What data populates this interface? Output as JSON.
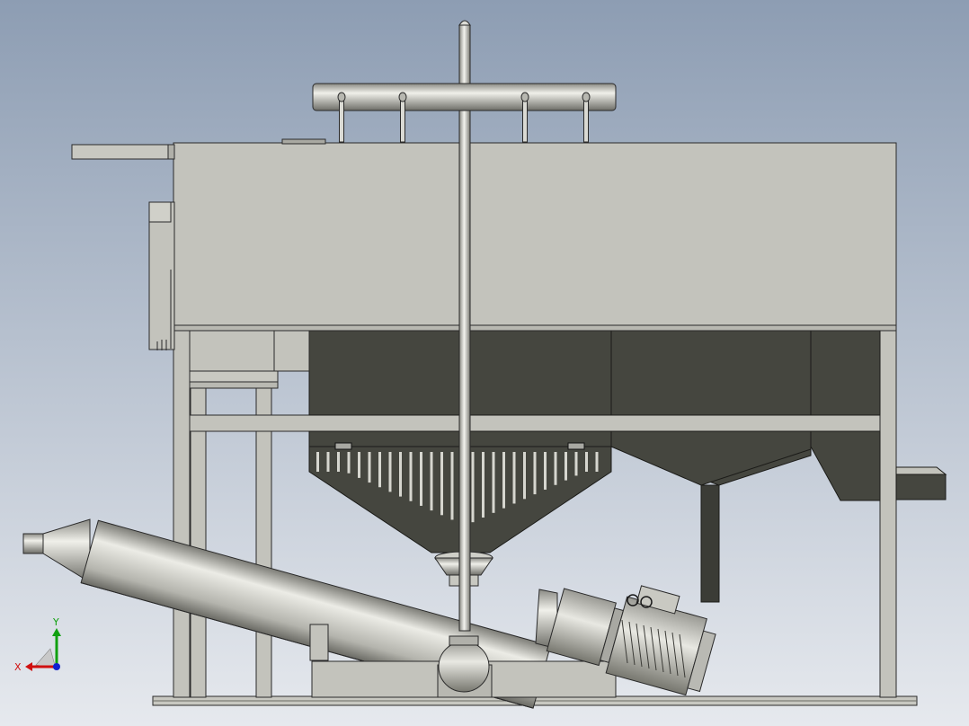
{
  "viewport": {
    "background_top": "#8d9db3",
    "background_bottom": "#e6e9ee",
    "view_orientation": "front"
  },
  "colors": {
    "body": "#c3c3bc",
    "body_light": "#d0d0c9",
    "steel_edge": "#2a2a2a",
    "hopper": "#45463f",
    "hopper_light": "#55564e"
  },
  "triad": {
    "x_label": "X",
    "y_label": "Y",
    "x_color": "#d01010",
    "y_color": "#10a010",
    "z_color": "#1020d0"
  }
}
